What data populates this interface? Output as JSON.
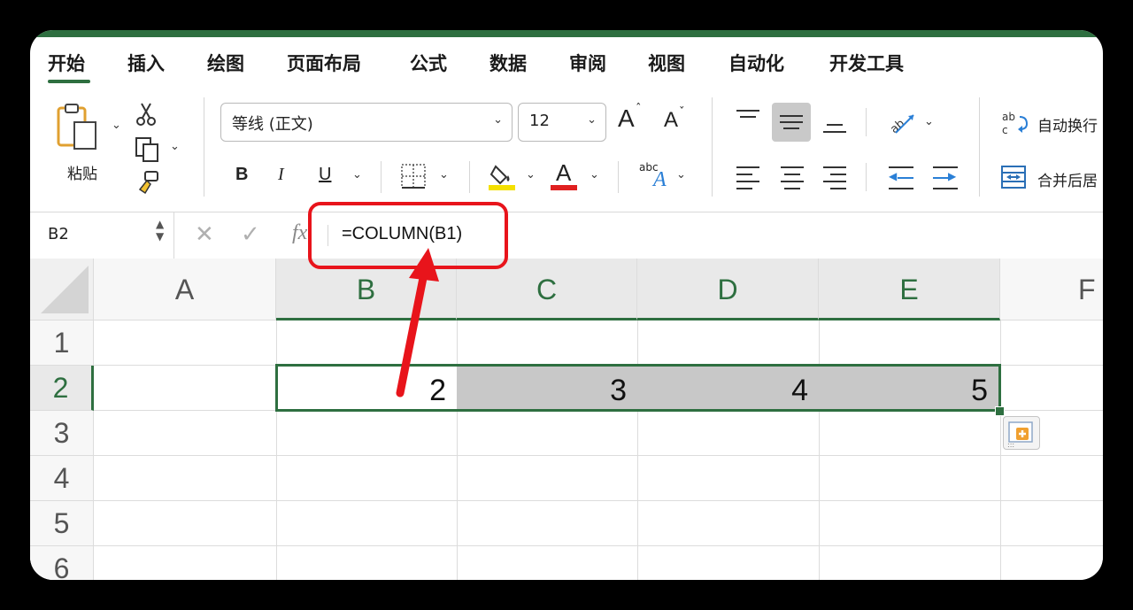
{
  "ribbon": {
    "tabs": [
      "开始",
      "插入",
      "绘图",
      "页面布局",
      "公式",
      "数据",
      "审阅",
      "视图",
      "自动化",
      "开发工具"
    ],
    "active_tab": "开始"
  },
  "clipboard": {
    "paste_label": "粘贴"
  },
  "font": {
    "family": "等线 (正文)",
    "size": "12",
    "bold": "B",
    "italic": "I",
    "underline": "U",
    "font_color_glyph": "A",
    "grow_glyph": "A",
    "shrink_glyph": "A",
    "orientation_glyph": "abc"
  },
  "alignment": {
    "wrap_text": "自动换行",
    "merge_center": "合并后居"
  },
  "formula_bar": {
    "name_box": "B2",
    "fx_label": "fx",
    "formula": "=COLUMN(B1)"
  },
  "grid": {
    "columns": [
      "A",
      "B",
      "C",
      "D",
      "E",
      "F"
    ],
    "rows": [
      "1",
      "2",
      "3",
      "4",
      "5",
      "6"
    ],
    "cells": {
      "B2": "2",
      "C2": "3",
      "D2": "4",
      "E2": "5"
    }
  },
  "colors": {
    "accent": "#2e6f40",
    "annotation": "#e8141b",
    "fill_yellow": "#f4e000",
    "font_red": "#e02020"
  }
}
